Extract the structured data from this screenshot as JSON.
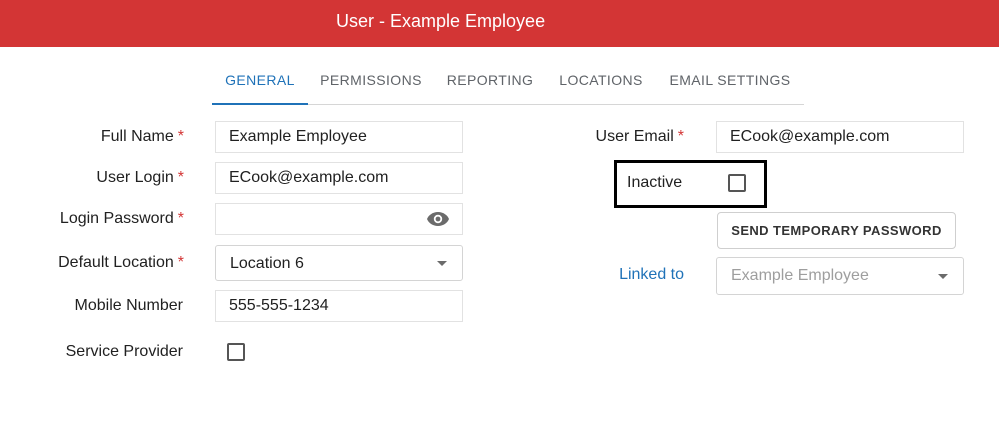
{
  "header": {
    "title": "User - Example Employee"
  },
  "tabs": [
    {
      "label": "GENERAL"
    },
    {
      "label": "PERMISSIONS"
    },
    {
      "label": "REPORTING"
    },
    {
      "label": "LOCATIONS"
    },
    {
      "label": "EMAIL SETTINGS"
    }
  ],
  "form": {
    "full_name": {
      "label": "Full Name",
      "required": "*",
      "value": "Example Employee"
    },
    "user_login": {
      "label": "User Login",
      "required": "*",
      "value": "ECook@example.com"
    },
    "login_password": {
      "label": "Login Password",
      "required": "*",
      "value": ""
    },
    "default_location": {
      "label": "Default Location",
      "required": "*",
      "value": "Location 6"
    },
    "mobile_number": {
      "label": "Mobile Number",
      "value": "555-555-1234"
    },
    "service_provider": {
      "label": "Service Provider",
      "checked": false
    },
    "user_email": {
      "label": "User Email",
      "required": "*",
      "value": "ECook@example.com"
    },
    "inactive": {
      "label": "Inactive",
      "checked": false
    },
    "send_temp_password": {
      "label": "SEND TEMPORARY PASSWORD"
    },
    "linked_to": {
      "label": "Linked to",
      "placeholder": "Example Employee"
    }
  },
  "colors": {
    "header": "#d33535",
    "accent": "#1f72b8",
    "required": "#d33535"
  },
  "icons": {
    "password_toggle": "eye-icon",
    "dropdown": "chevron-down-icon"
  }
}
